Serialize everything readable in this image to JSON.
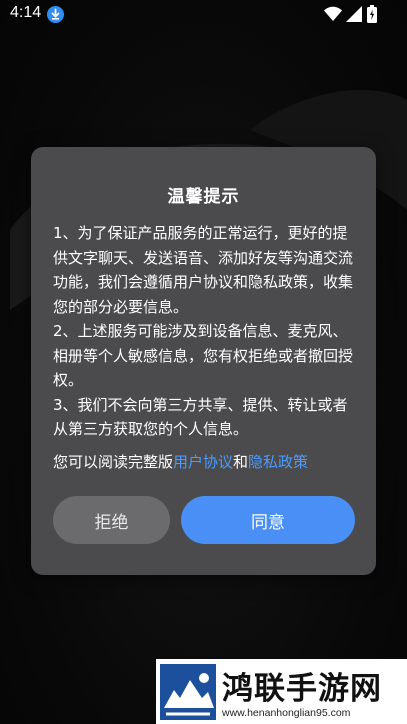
{
  "status_bar": {
    "time": "4:14",
    "icons": [
      "download-icon",
      "wifi-icon",
      "signal-icon",
      "battery-icon"
    ]
  },
  "dialog": {
    "title": "温馨提示",
    "paragraphs": [
      "1、为了保证产品服务的正常运行，更好的提供文字聊天、发送语音、添加好友等沟通交流功能，我们会遵循用户协议和隐私政策，收集您的部分必要信息。",
      "2、上述服务可能涉及到设备信息、麦克风、相册等个人敏感信息，您有权拒绝或者撤回授权。",
      "3、我们不会向第三方共享、提供、转让或者从第三方获取您的个人信息。"
    ],
    "agreement": {
      "prefix": "您可以阅读完整版",
      "user_agreement_link": "用户协议",
      "and": "和",
      "privacy_policy_link": "隐私政策"
    },
    "buttons": {
      "refuse": "拒绝",
      "agree": "同意"
    }
  },
  "watermark": {
    "title": "鸿联手游网",
    "url": "www.henanhonglian95.com"
  },
  "colors": {
    "dialog_bg": "#4b4b4d",
    "link": "#4a9bff",
    "agree_button": "#4a8ff5",
    "refuse_button": "#6b6b6d"
  }
}
